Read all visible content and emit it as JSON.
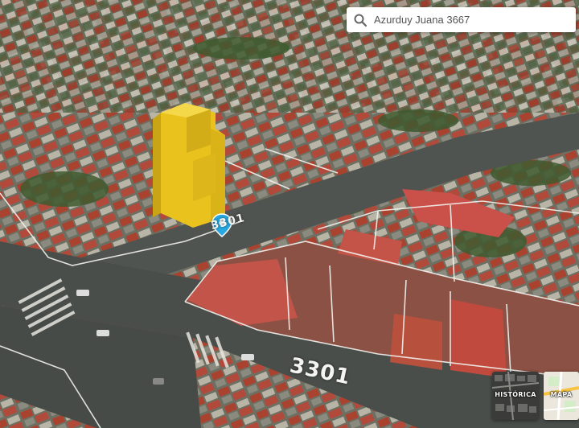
{
  "search": {
    "value": "Azurduy Juana 3667",
    "icon": "search-icon"
  },
  "map": {
    "view": "3D satellite",
    "marker": {
      "color": "#27a8e0",
      "icon": "location-pin-icon"
    },
    "building": {
      "color": "#e9c21e"
    },
    "street_numbers": [
      "3301",
      "3301"
    ]
  },
  "layers": {
    "historic_label": "HISTÓRICA",
    "map_label": "MAPA"
  }
}
